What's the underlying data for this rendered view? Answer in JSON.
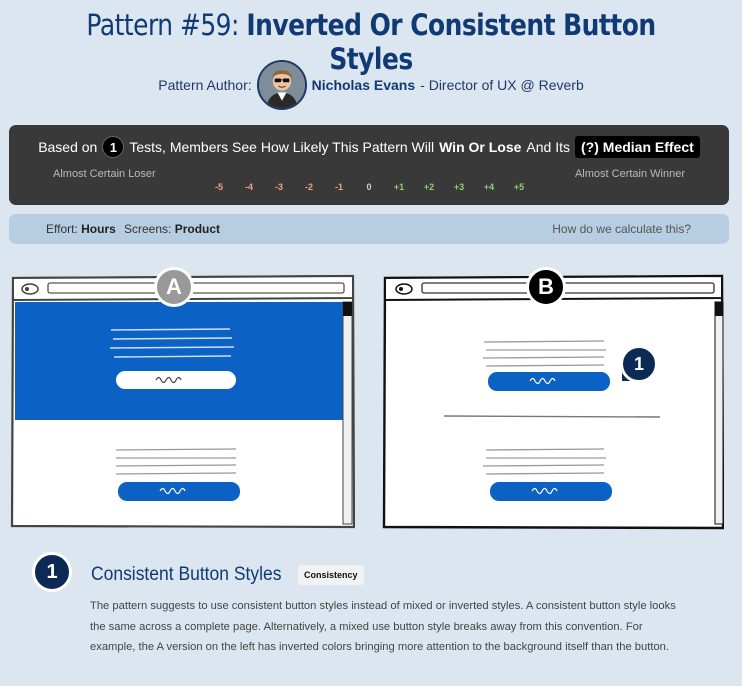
{
  "header": {
    "title_prefix": "Pattern #59:",
    "title_bold": "Inverted Or Consistent Button Styles"
  },
  "author": {
    "label": "Pattern Author:",
    "name": "Nicholas Evans",
    "role": "- Director of UX @ Reverb"
  },
  "effect": {
    "based_on": "Based on",
    "tests_count": "1",
    "tests_text": "Tests, Members See How Likely This Pattern Will",
    "win_or_lose": "Win Or Lose",
    "and_its": "And Its",
    "median_effect": "(?) Median Effect",
    "loser_label": "Almost Certain Loser",
    "winner_label": "Almost Certain Winner",
    "scale": [
      "-5",
      "-4",
      "-3",
      "-2",
      "-1",
      "0",
      "+1",
      "+2",
      "+3",
      "+4",
      "+5"
    ]
  },
  "meta": {
    "effort_label": "Effort:",
    "effort_value": "Hours",
    "screens_label": "Screens:",
    "screens_value": "Product",
    "calc_link": "How do we calculate this?"
  },
  "variants": {
    "a_label": "A",
    "b_label": "B",
    "marker": "1"
  },
  "colors": {
    "accent_blue": "#0b61c4",
    "navy": "#0f3a73",
    "panel_dark": "#393939",
    "page_bg": "#dce6f1"
  },
  "detail": {
    "number": "1",
    "title": "Consistent Button Styles",
    "tag": "Consistency",
    "body": "The pattern suggests to use consistent button styles instead of mixed or inverted styles. A consistent button style looks the same across a complete page. Alternatively, a mixed use button style breaks away from this convention. For example, the A version on the left has inverted colors bringing more attention to the background itself than the button."
  }
}
